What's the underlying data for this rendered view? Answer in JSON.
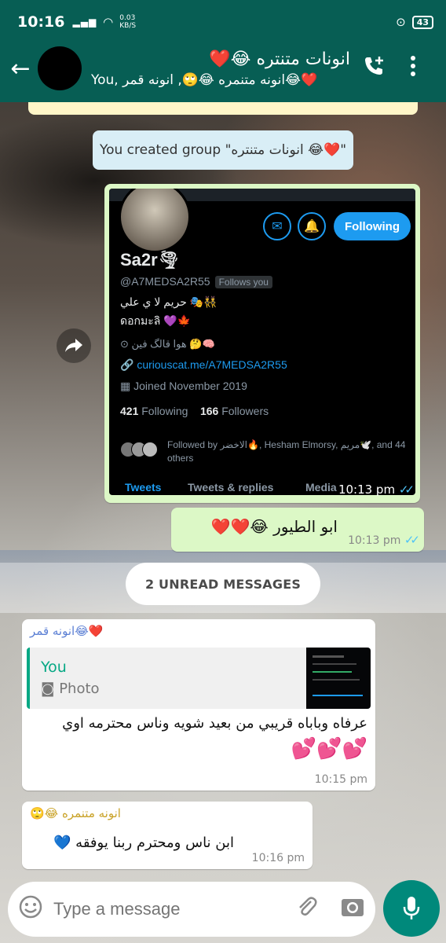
{
  "status_bar": {
    "time": "10:16",
    "net_speed": "0.03",
    "net_unit": "KB/S",
    "battery": "43"
  },
  "header": {
    "group_name": "انونات متنتره 😂❤️",
    "participants": "You, انونه متنمره 😂🙄, انونه قمر😂❤️"
  },
  "system_message": "You created group \"انونات متنتره 😂❤️\"",
  "shared_profile": {
    "name": "Sa2r🌪",
    "handle": "@A7MEDSA2R55",
    "follows_you": "Follows you",
    "follow_button": "Following",
    "bio_line1": "حريم لا ي علي 🎭👯",
    "bio_line2": "ดอกมะลิ 💜🍁",
    "location": "هوا قالگ فين 🤔🧠",
    "link": "curiouscat.me/A7MEDSA2R55",
    "joined": "Joined November 2019",
    "following_count": "421",
    "following_label": "Following",
    "followers_count": "166",
    "followers_label": "Followers",
    "followed_by": "Followed by الاخضر🔥, Hesham Elmorsy, مريم🕊️, and 44 others",
    "tabs": [
      "Tweets",
      "Tweets & replies",
      "Media"
    ],
    "time": "10:13 pm"
  },
  "msg_out_2": {
    "text": "ابو الطيور 😂❤️❤️",
    "time": "10:13 pm"
  },
  "unread_label": "2 UNREAD MESSAGES",
  "msg_in_1": {
    "sender": "انونه قمر😂❤️",
    "quote_author": "You",
    "quote_type": "Photo",
    "text_line1": "عرفاه وباباه قريبي من بعيد شويه وناس محترمه اوي",
    "text_line2": "💕💕💕",
    "time": "10:15 pm"
  },
  "msg_in_2": {
    "sender": "انونه متنمره 😂🙄",
    "text": "ابن ناس ومحترم ربنا يوفقه 💙",
    "time": "10:16 pm"
  },
  "input": {
    "placeholder": "Type a message"
  },
  "colors": {
    "header": "#075e54",
    "outgoing": "#dcf8c6",
    "accent": "#00897b",
    "ticks": "#4fc3f7"
  }
}
